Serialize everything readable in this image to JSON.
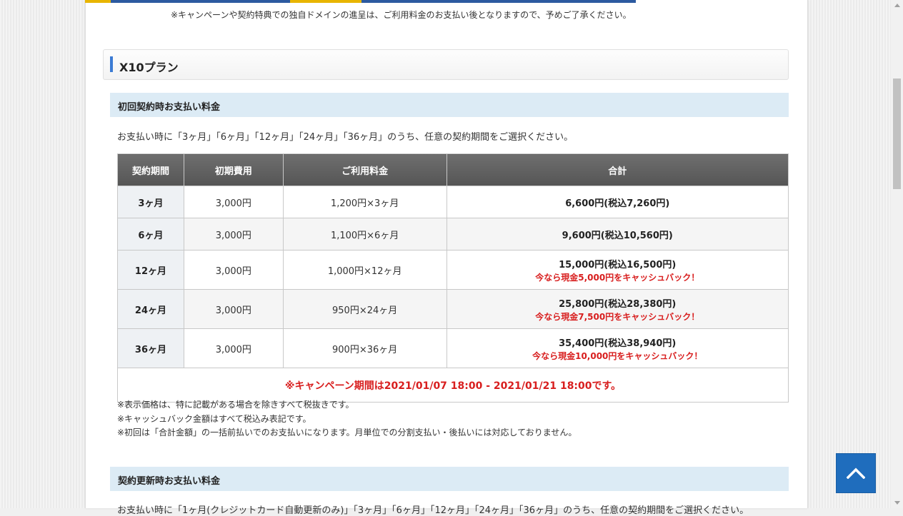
{
  "top_note": "※キャンペーンや契約特典での独自ドメインの進呈は、ご利用料金のお支払い後となりますので、予めご了承ください。",
  "plan": {
    "title": "X10プラン"
  },
  "initial_section": {
    "title": "初回契約時お支払い料金",
    "intro": "お支払い時に「3ヶ月」「6ヶ月」「12ヶ月」「24ヶ月」「36ヶ月」のうち、任意の契約期間をご選択ください。"
  },
  "table": {
    "headers": [
      "契約期間",
      "初期費用",
      "ご利用料金",
      "合計"
    ],
    "rows": [
      {
        "period": "3ヶ月",
        "setup": "3,000円",
        "usage": "1,200円×3ヶ月",
        "total": "6,600円(税込7,260円)",
        "cashback": ""
      },
      {
        "period": "6ヶ月",
        "setup": "3,000円",
        "usage": "1,100円×6ヶ月",
        "total": "9,600円(税込10,560円)",
        "cashback": ""
      },
      {
        "period": "12ヶ月",
        "setup": "3,000円",
        "usage": "1,000円×12ヶ月",
        "total": "15,000円(税込16,500円)",
        "cashback": "今なら現金5,000円をキャッシュバック！"
      },
      {
        "period": "24ヶ月",
        "setup": "3,000円",
        "usage": "950円×24ヶ月",
        "total": "25,800円(税込28,380円)",
        "cashback": "今なら現金7,500円をキャッシュバック！"
      },
      {
        "period": "36ヶ月",
        "setup": "3,000円",
        "usage": "900円×36ヶ月",
        "total": "35,400円(税込38,940円)",
        "cashback": "今なら現金10,000円をキャッシュバック！"
      }
    ],
    "campaign": "※キャンペーン期間は2021/01/07 18:00 - 2021/01/21 18:00です。"
  },
  "notes": [
    "※表示価格は、特に記載がある場合を除きすべて税抜きです。",
    "※キャッシュバック金額はすべて税込み表記です。",
    "※初回は「合計金額」の一括前払いでのお支払いになります。月単位での分割支払い・後払いには対応しておりません。"
  ],
  "renewal_section": {
    "title": "契約更新時お支払い料金",
    "intro": "お支払い時に「1ヶ月(クレジットカード自動更新のみ)」「3ヶ月」「6ヶ月」「12ヶ月」「24ヶ月」「36ヶ月」のうち、任意の契約期間をご選択ください。"
  },
  "icons": {
    "back_to_top": "chevron-up-icon"
  },
  "colors": {
    "accent_blue": "#1f6dbd",
    "section_bg": "#dcebf5",
    "campaign_red": "#d81e1e",
    "header_gray": "#606060"
  }
}
